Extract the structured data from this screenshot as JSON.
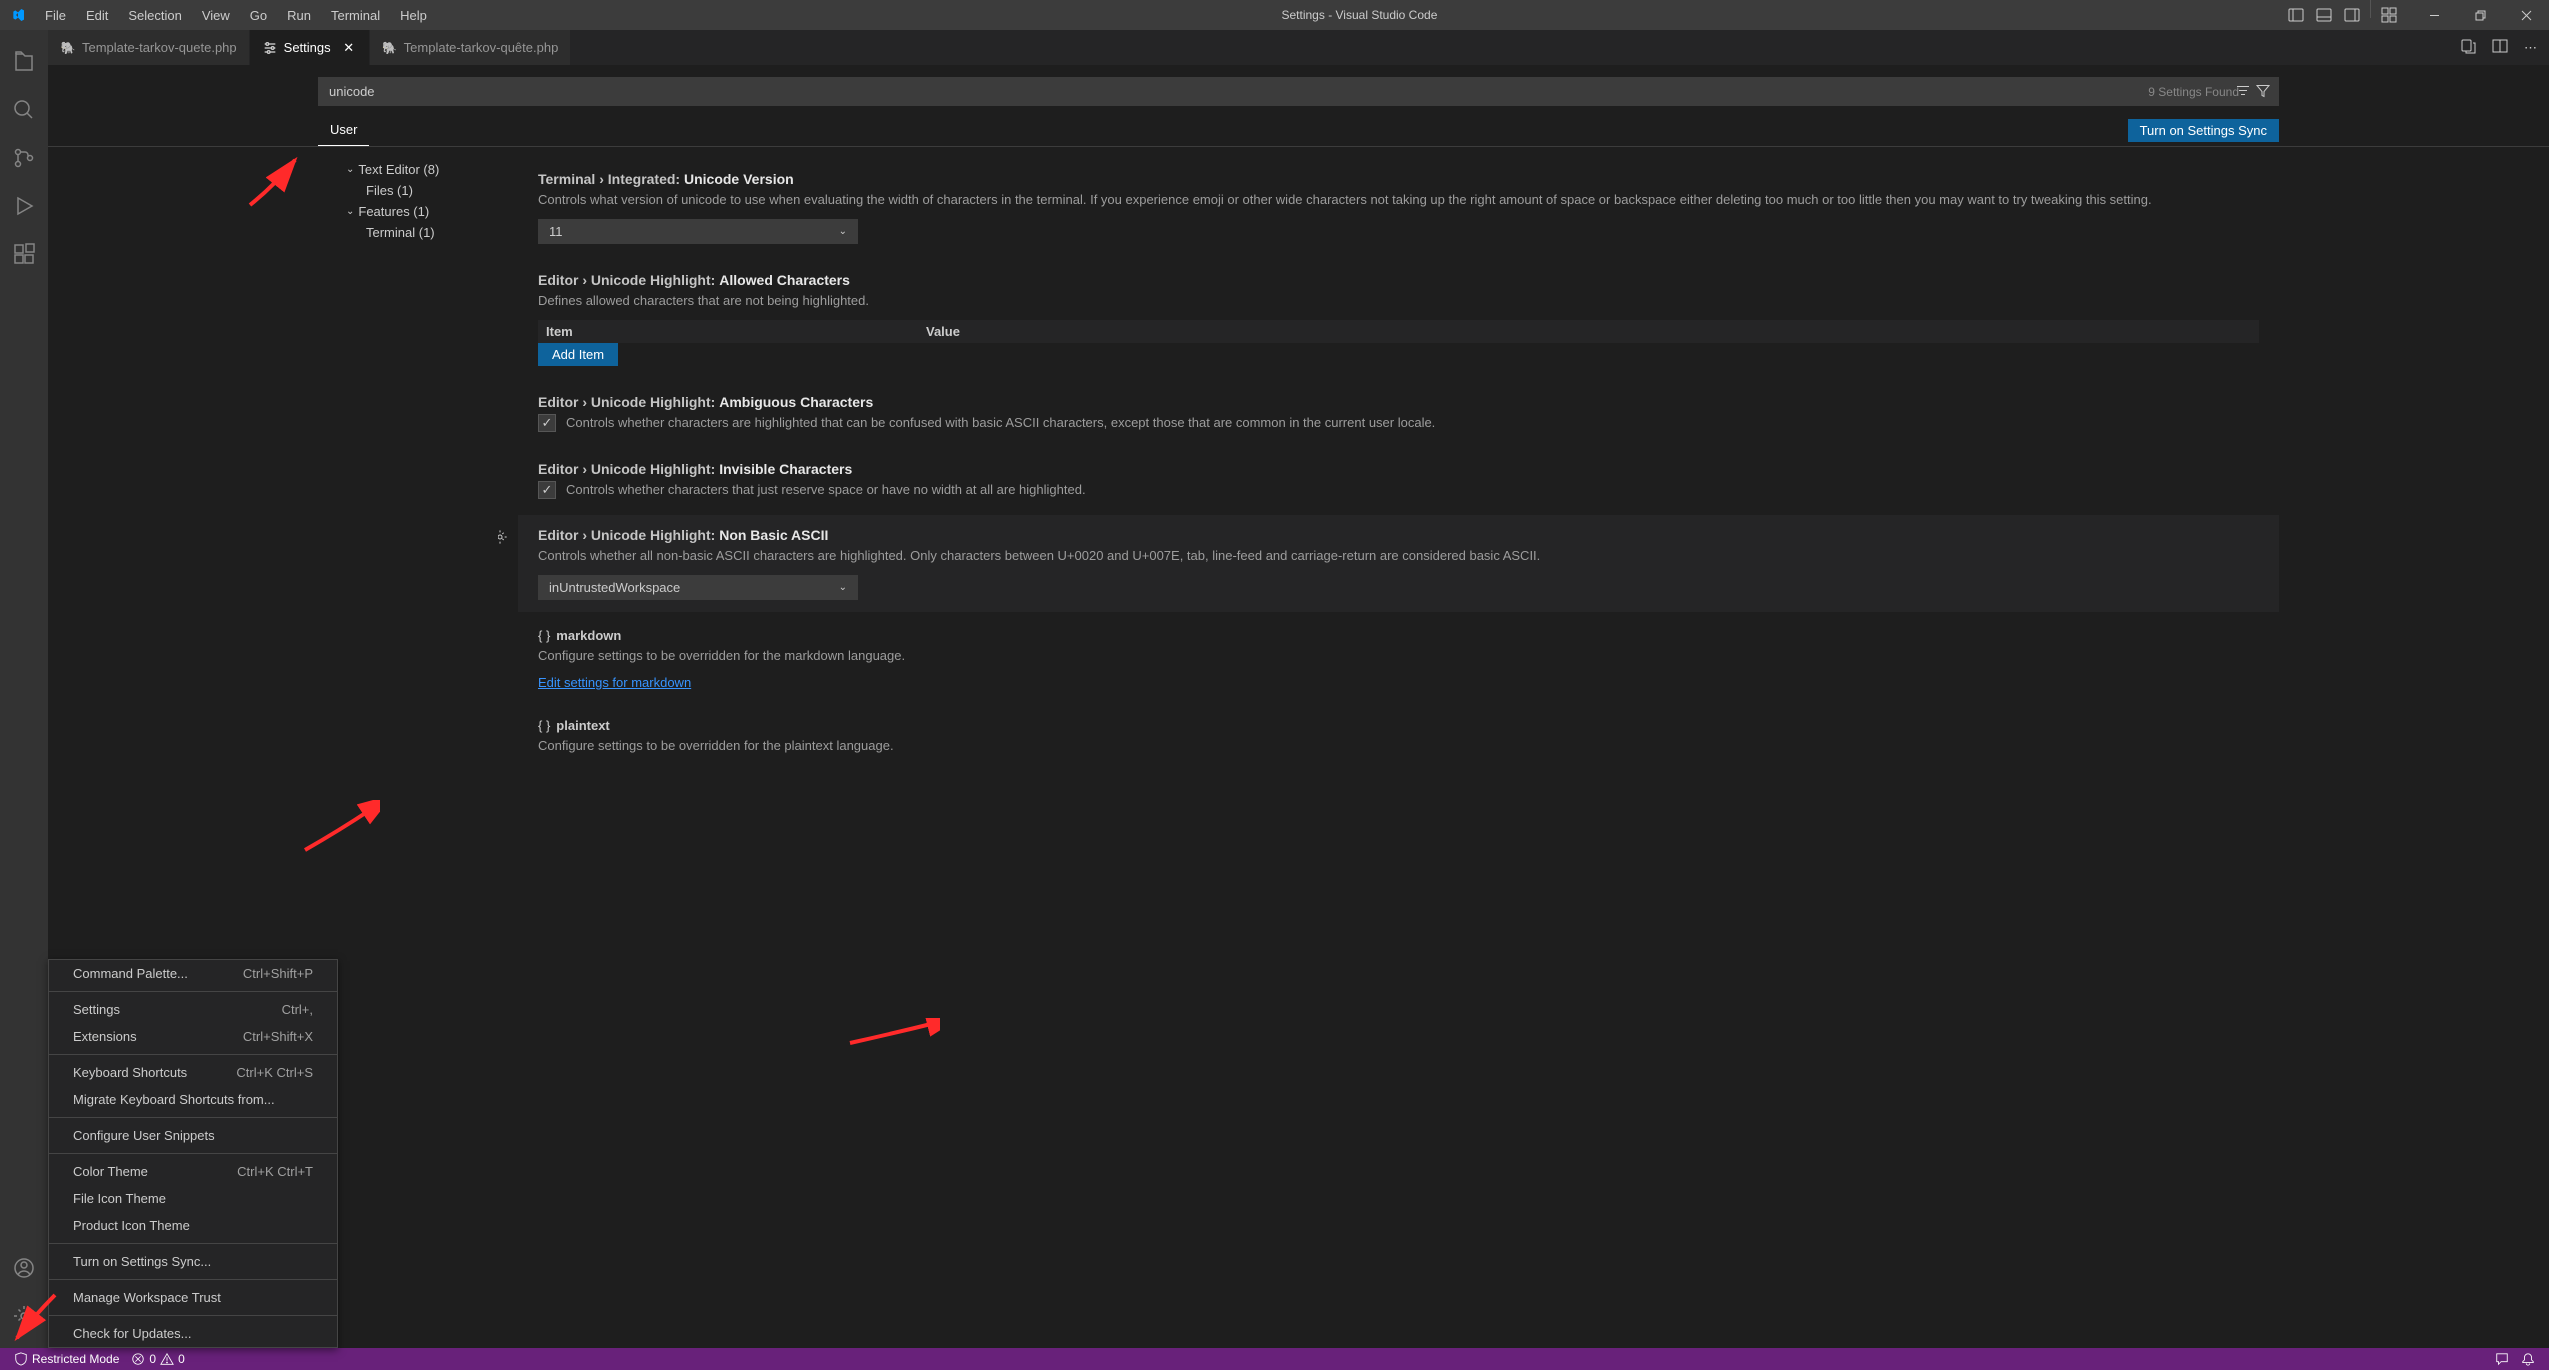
{
  "title": "Settings - Visual Studio Code",
  "menu": [
    "File",
    "Edit",
    "Selection",
    "View",
    "Go",
    "Run",
    "Terminal",
    "Help"
  ],
  "tabs": [
    {
      "label": "Template-tarkov-quete.php",
      "icon": "php",
      "active": false
    },
    {
      "label": "Settings",
      "icon": "settings",
      "active": true
    },
    {
      "label": "Template-tarkov-quête.php",
      "icon": "php",
      "active": false
    }
  ],
  "search": {
    "value": "unicode",
    "found": "9 Settings Found"
  },
  "scope": {
    "user": "User",
    "sync_btn": "Turn on Settings Sync"
  },
  "toc": [
    {
      "label": "Text Editor (8)",
      "expanded": true,
      "level": 1
    },
    {
      "label": "Files (1)",
      "level": 2
    },
    {
      "label": "Features (1)",
      "expanded": true,
      "level": 1
    },
    {
      "label": "Terminal (1)",
      "level": 2
    }
  ],
  "settings": {
    "terminal_unicode": {
      "prefix": "Terminal › Integrated:",
      "name": "Unicode Version",
      "desc": "Controls what version of unicode to use when evaluating the width of characters in the terminal. If you experience emoji or other wide characters not taking up the right amount of space or backspace either deleting too much or too little then you may want to try tweaking this setting.",
      "value": "11"
    },
    "allowed_chars": {
      "prefix": "Editor › Unicode Highlight:",
      "name": "Allowed Characters",
      "desc": "Defines allowed characters that are not being highlighted.",
      "col1": "Item",
      "col2": "Value",
      "add": "Add Item"
    },
    "ambiguous": {
      "prefix": "Editor › Unicode Highlight:",
      "name": "Ambiguous Characters",
      "desc": "Controls whether characters are highlighted that can be confused with basic ASCII characters, except those that are common in the current user locale."
    },
    "invisible": {
      "prefix": "Editor › Unicode Highlight:",
      "name": "Invisible Characters",
      "desc": "Controls whether characters that just reserve space or have no width at all are highlighted."
    },
    "nonbasic": {
      "prefix": "Editor › Unicode Highlight:",
      "name": "Non Basic ASCII",
      "desc": "Controls whether all non-basic ASCII characters are highlighted. Only characters between U+0020 and U+007E, tab, line-feed and carriage-return are considered basic ASCII.",
      "value": "inUntrustedWorkspace"
    },
    "markdown": {
      "lang": "markdown",
      "desc": "Configure settings to be overridden for the markdown language.",
      "link": "Edit settings for markdown"
    },
    "plaintext": {
      "lang": "plaintext",
      "desc": "Configure settings to be overridden for the plaintext language."
    }
  },
  "context_menu": [
    {
      "label": "Command Palette...",
      "shortcut": "Ctrl+Shift+P"
    },
    {
      "sep": true
    },
    {
      "label": "Settings",
      "shortcut": "Ctrl+,"
    },
    {
      "label": "Extensions",
      "shortcut": "Ctrl+Shift+X"
    },
    {
      "sep": true
    },
    {
      "label": "Keyboard Shortcuts",
      "shortcut": "Ctrl+K Ctrl+S"
    },
    {
      "label": "Migrate Keyboard Shortcuts from..."
    },
    {
      "sep": true
    },
    {
      "label": "Configure User Snippets"
    },
    {
      "sep": true
    },
    {
      "label": "Color Theme",
      "shortcut": "Ctrl+K Ctrl+T"
    },
    {
      "label": "File Icon Theme"
    },
    {
      "label": "Product Icon Theme"
    },
    {
      "sep": true
    },
    {
      "label": "Turn on Settings Sync..."
    },
    {
      "sep": true
    },
    {
      "label": "Manage Workspace Trust"
    },
    {
      "sep": true
    },
    {
      "label": "Check for Updates..."
    }
  ],
  "status": {
    "restricted": "Restricted Mode",
    "errors": "0",
    "warnings": "0"
  }
}
